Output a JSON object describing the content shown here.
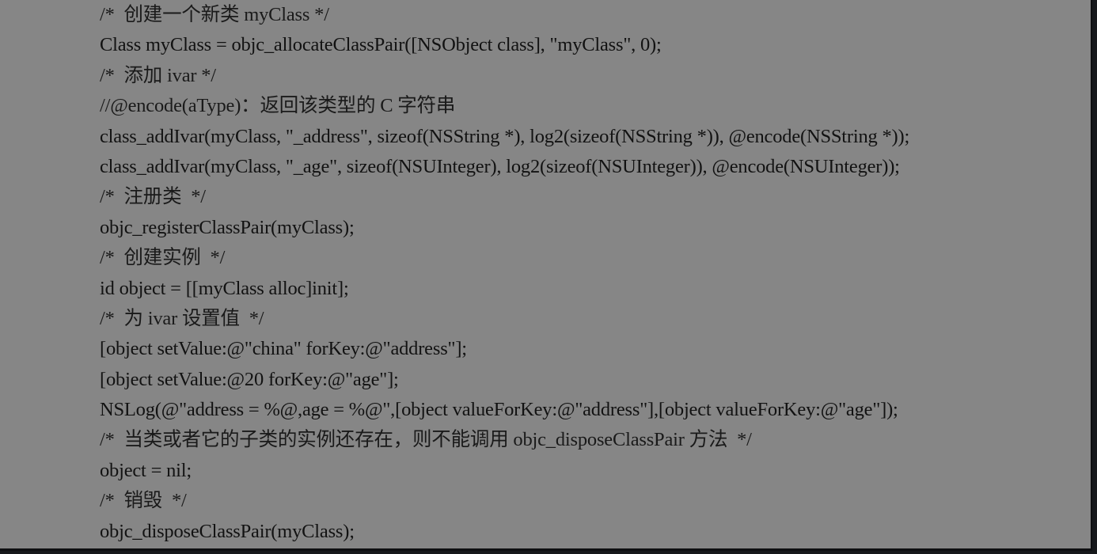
{
  "code": {
    "lines": [
      {
        "text": "/*  创建一个新类 myClass */",
        "kind": "comment"
      },
      {
        "text": "Class myClass = objc_allocateClassPair([NSObject class], \"myClass\", 0);",
        "kind": "code"
      },
      {
        "text": "/*  添加 ivar */",
        "kind": "comment"
      },
      {
        "text": "//@encode(aType)：返回该类型的 C 字符串",
        "kind": "comment"
      },
      {
        "text": "class_addIvar(myClass, \"_address\", sizeof(NSString *), log2(sizeof(NSString *)), @encode(NSString *));",
        "kind": "code"
      },
      {
        "text": "class_addIvar(myClass, \"_age\", sizeof(NSUInteger), log2(sizeof(NSUInteger)), @encode(NSUInteger));",
        "kind": "code"
      },
      {
        "text": "/*  注册类  */",
        "kind": "comment"
      },
      {
        "text": "objc_registerClassPair(myClass);",
        "kind": "code"
      },
      {
        "text": "/*  创建实例  */",
        "kind": "comment"
      },
      {
        "text": "id object = [[myClass alloc]init];",
        "kind": "code"
      },
      {
        "text": "/*  为 ivar 设置值  */",
        "kind": "comment"
      },
      {
        "text": "[object setValue:@\"china\" forKey:@\"address\"];",
        "kind": "code"
      },
      {
        "text": "[object setValue:@20 forKey:@\"age\"];",
        "kind": "code"
      },
      {
        "text": "NSLog(@\"address = %@,age = %@\",[object valueForKey:@\"address\"],[object valueForKey:@\"age\"]);",
        "kind": "code"
      },
      {
        "text": "/*  当类或者它的子类的实例还存在，则不能调用 objc_disposeClassPair 方法  */",
        "kind": "comment"
      },
      {
        "text": "object = nil;",
        "kind": "code"
      },
      {
        "text": "/*  销毁  */",
        "kind": "comment"
      },
      {
        "text": "objc_disposeClassPair(myClass);",
        "kind": "code"
      }
    ]
  }
}
